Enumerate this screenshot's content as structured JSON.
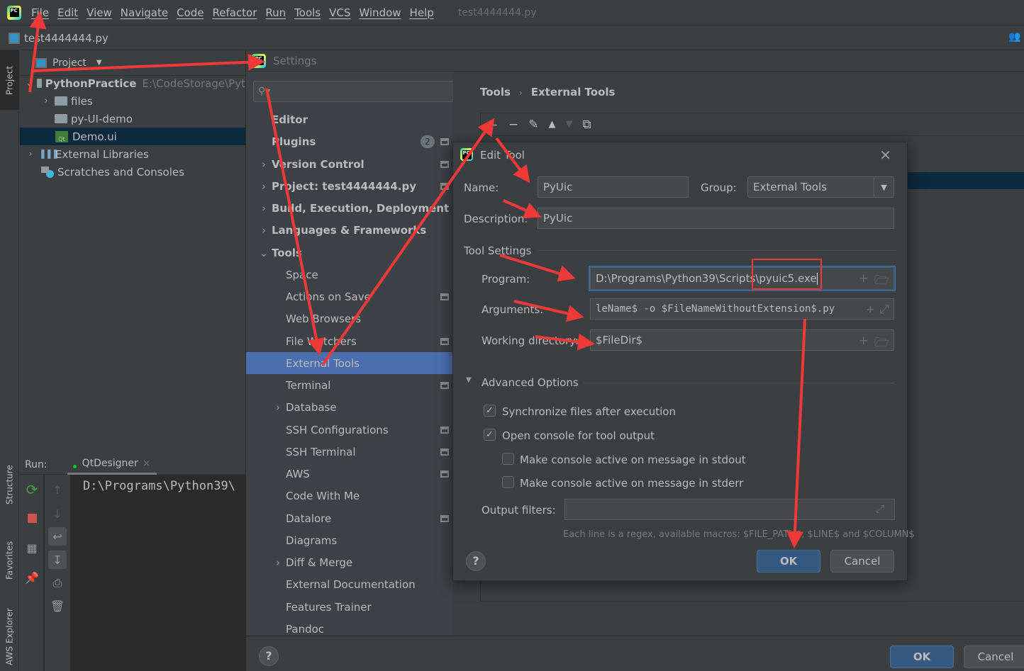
{
  "menubar": {
    "items": [
      "File",
      "Edit",
      "View",
      "Navigate",
      "Code",
      "Refactor",
      "Run",
      "Tools",
      "VCS",
      "Window",
      "Help"
    ],
    "window_title": "test4444444.py"
  },
  "filebar": {
    "file_name": "test4444444.py"
  },
  "left_stripe": {
    "project": "Project",
    "structure": "Structure",
    "favorites": "Favorites",
    "aws_explorer": "AWS Explorer"
  },
  "project_panel": {
    "title": "Project",
    "tree": [
      {
        "label": "PythonPractice",
        "path": "E:\\CodeStorage\\Pyt",
        "expanded": true,
        "icon": "folder-icon"
      },
      {
        "label": "files",
        "expanded": false,
        "icon": "folder-icon"
      },
      {
        "label": "py-UI-demo",
        "icon": "folder-icon"
      },
      {
        "label": "Demo.ui",
        "icon": "qt-ui-file-icon",
        "selected": true
      },
      {
        "label": "External Libraries",
        "expanded": false,
        "icon": "library-icon"
      },
      {
        "label": "Scratches and Consoles",
        "icon": "scratches-icon"
      }
    ]
  },
  "run_panel": {
    "label": "Run:",
    "tab": "QtDesigner",
    "console_text": "D:\\Programs\\Python39\\"
  },
  "settings": {
    "title": "Settings",
    "search_placeholder": "",
    "nav": [
      {
        "label": "Editor",
        "bold": true
      },
      {
        "label": "Plugins",
        "bold": true,
        "badge": "2",
        "project_level": true
      },
      {
        "label": "Version Control",
        "bold": true,
        "expandable": true,
        "project_level": true
      },
      {
        "label": "Project: test4444444.py",
        "bold": true,
        "expandable": true,
        "project_level": true
      },
      {
        "label": "Build, Execution, Deployment",
        "bold": true,
        "expandable": true
      },
      {
        "label": "Languages & Frameworks",
        "bold": true,
        "expandable": true
      },
      {
        "label": "Tools",
        "bold": true,
        "expanded": true
      },
      {
        "label": "Space"
      },
      {
        "label": "Actions on Save",
        "project_level": true
      },
      {
        "label": "Web Browsers"
      },
      {
        "label": "File Watchers",
        "project_level": true
      },
      {
        "label": "External Tools",
        "selected": true
      },
      {
        "label": "Terminal",
        "project_level": true
      },
      {
        "label": "Database",
        "expandable": true
      },
      {
        "label": "SSH Configurations",
        "project_level": true
      },
      {
        "label": "SSH Terminal",
        "project_level": true
      },
      {
        "label": "AWS",
        "project_level": true
      },
      {
        "label": "Code With Me"
      },
      {
        "label": "Datalore",
        "project_level": true
      },
      {
        "label": "Diagrams"
      },
      {
        "label": "Diff & Merge",
        "expandable": true
      },
      {
        "label": "External Documentation"
      },
      {
        "label": "Features Trainer"
      },
      {
        "label": "Pandoc"
      }
    ],
    "breadcrumb": [
      "Tools",
      "External Tools"
    ],
    "toolbar": [
      "add-icon",
      "remove-icon",
      "edit-icon",
      "move-up-icon",
      "move-down-icon",
      "copy-icon"
    ],
    "ok_label": "OK",
    "cancel_label": "Cancel"
  },
  "edit_tool": {
    "title": "Edit Tool",
    "name_label": "Name:",
    "name_value": "PyUic",
    "group_label": "Group:",
    "group_value": "External Tools",
    "description_label": "Description:",
    "description_value": "PyUic",
    "tool_settings_label": "Tool Settings",
    "program_label": "Program:",
    "program_value": "D:\\Programs\\Python39\\Scripts\\pyuic5.exe",
    "arguments_label": "Arguments:",
    "arguments_value": "leName$ -o $FileNameWithoutExtension$.py",
    "working_dir_label": "Working directory:",
    "working_dir_value": "$FileDir$",
    "advanced_label": "Advanced Options",
    "options": [
      {
        "label": "Synchronize files after execution",
        "checked": true
      },
      {
        "label": "Open console for tool output",
        "checked": true
      },
      {
        "label": "Make console active on message in stdout",
        "checked": false
      },
      {
        "label": "Make console active on message in stderr",
        "checked": false
      }
    ],
    "output_filters_label": "Output filters:",
    "output_filters_value": "",
    "hint": "Each line is a regex, available macros: $FILE_PATH$, $LINE$ and $COLUMN$",
    "ok_label": "OK",
    "cancel_label": "Cancel"
  },
  "colors": {
    "accent": "#4b6eaf",
    "primary_button": "#365880",
    "annotation": "#f03a3a"
  }
}
